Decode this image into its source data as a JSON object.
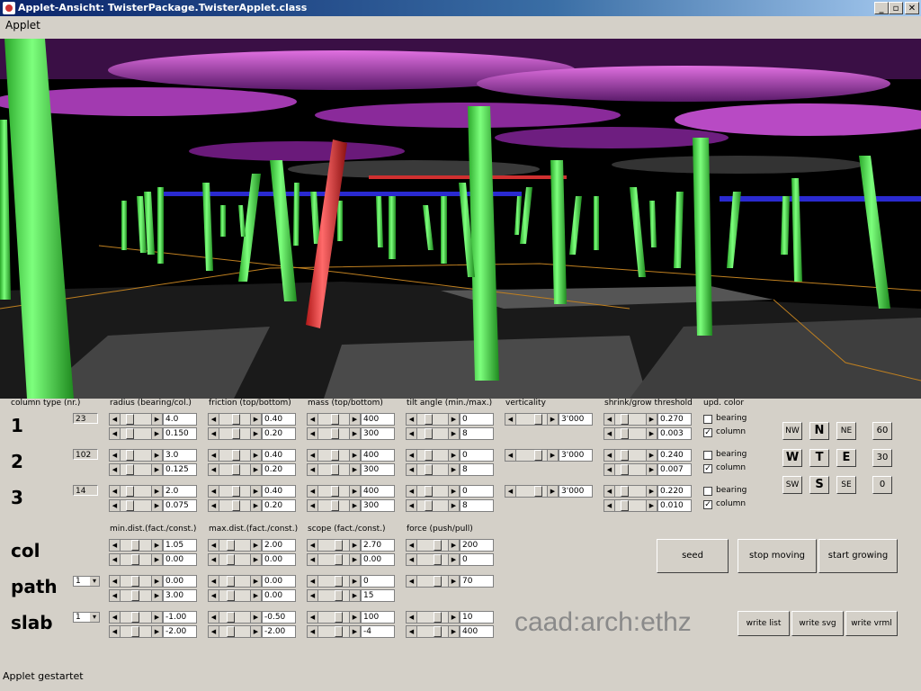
{
  "window": {
    "title": "Applet-Ansicht: TwisterPackage.TwisterApplet.class",
    "min": "_",
    "max": "▫",
    "close": "✕"
  },
  "menu": {
    "applet": "Applet"
  },
  "headers": {
    "column_type": "column type (nr.)",
    "radius": "radius (bearing/col.)",
    "friction": "friction (top/bottom)",
    "mass": "mass (top/bottom)",
    "tilt": "tilt angle (min./max.)",
    "verticality": "verticality",
    "shrink": "shrink/grow threshold",
    "upd_color": "upd. color",
    "min_dist": "min.dist.(fact./const.)",
    "max_dist": "max.dist.(fact./const.)",
    "scope": "scope (fact./const.)",
    "force": "force (push/pull)"
  },
  "rows": [
    {
      "label": "1",
      "nr": "23",
      "radius": [
        "4.0",
        "0.150"
      ],
      "friction": [
        "0.40",
        "0.20"
      ],
      "mass": [
        "400",
        "300"
      ],
      "tilt": [
        "0",
        "8"
      ],
      "vert": "3'000",
      "shrink": [
        "0.270",
        "0.003"
      ],
      "bearing": false,
      "column": true
    },
    {
      "label": "2",
      "nr": "102",
      "radius": [
        "3.0",
        "0.125"
      ],
      "friction": [
        "0.40",
        "0.20"
      ],
      "mass": [
        "400",
        "300"
      ],
      "tilt": [
        "0",
        "8"
      ],
      "vert": "3'000",
      "shrink": [
        "0.240",
        "0.007"
      ],
      "bearing": false,
      "column": true
    },
    {
      "label": "3",
      "nr": "14",
      "radius": [
        "2.0",
        "0.075"
      ],
      "friction": [
        "0.40",
        "0.20"
      ],
      "mass": [
        "400",
        "300"
      ],
      "tilt": [
        "0",
        "8"
      ],
      "vert": "3'000",
      "shrink": [
        "0.220",
        "0.010"
      ],
      "bearing": false,
      "column": true
    }
  ],
  "checkbox_labels": {
    "bearing": "bearing",
    "column": "column"
  },
  "lower": {
    "col": {
      "label": "col",
      "min": [
        "1.05",
        "0.00"
      ],
      "max": [
        "2.00",
        "0.00"
      ],
      "scope": [
        "2.70",
        "0.00"
      ],
      "force": [
        "200",
        "0"
      ]
    },
    "path": {
      "label": "path",
      "dd": "1",
      "min": [
        "0.00",
        "3.00"
      ],
      "max": [
        "0.00",
        "0.00"
      ],
      "scope": [
        "0",
        "15"
      ],
      "force": [
        "70"
      ]
    },
    "slab": {
      "label": "slab",
      "dd": "1",
      "min": [
        "-1.00",
        "-2.00"
      ],
      "max": [
        "-0.50",
        "-2.00"
      ],
      "scope": [
        "100",
        "-4"
      ],
      "force": [
        "10",
        "400"
      ]
    }
  },
  "compass": {
    "nw": "NW",
    "n": "N",
    "ne": "NE",
    "w": "W",
    "t": "T",
    "e": "E",
    "sw": "SW",
    "s": "S",
    "se": "SE"
  },
  "numbers": {
    "n60": "60",
    "n30": "30",
    "n0": "0"
  },
  "buttons": {
    "seed": "seed",
    "stop": "stop moving",
    "start": "start growing",
    "write_list": "write list",
    "write_svg": "write svg",
    "write_vrml": "write vrml"
  },
  "logo": "caad:arch:ethz",
  "status": "Applet gestartet",
  "colors": {
    "viewport_bg": "#000000",
    "column_green": "#4cff4c",
    "column_red": "#ff3333",
    "slab_purple": "#b03ab0"
  }
}
